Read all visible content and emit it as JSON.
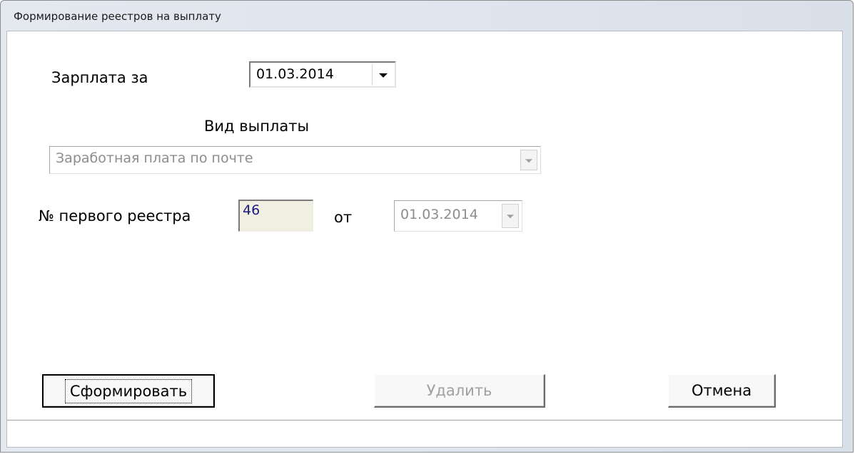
{
  "window": {
    "title": "Формирование реестров на выплату"
  },
  "salary_for": {
    "label": "Зарплата за",
    "value": "01.03.2014"
  },
  "payment_type": {
    "label": "Вид выплаты",
    "value": "Заработная плата по почте"
  },
  "first_register": {
    "label": "№ первого реестра",
    "number": "46",
    "from_label": "от",
    "date": "01.03.2014"
  },
  "buttons": {
    "generate": "Сформировать",
    "delete": "Удалить",
    "cancel": "Отмена"
  },
  "status_bar": {
    "text": ""
  }
}
